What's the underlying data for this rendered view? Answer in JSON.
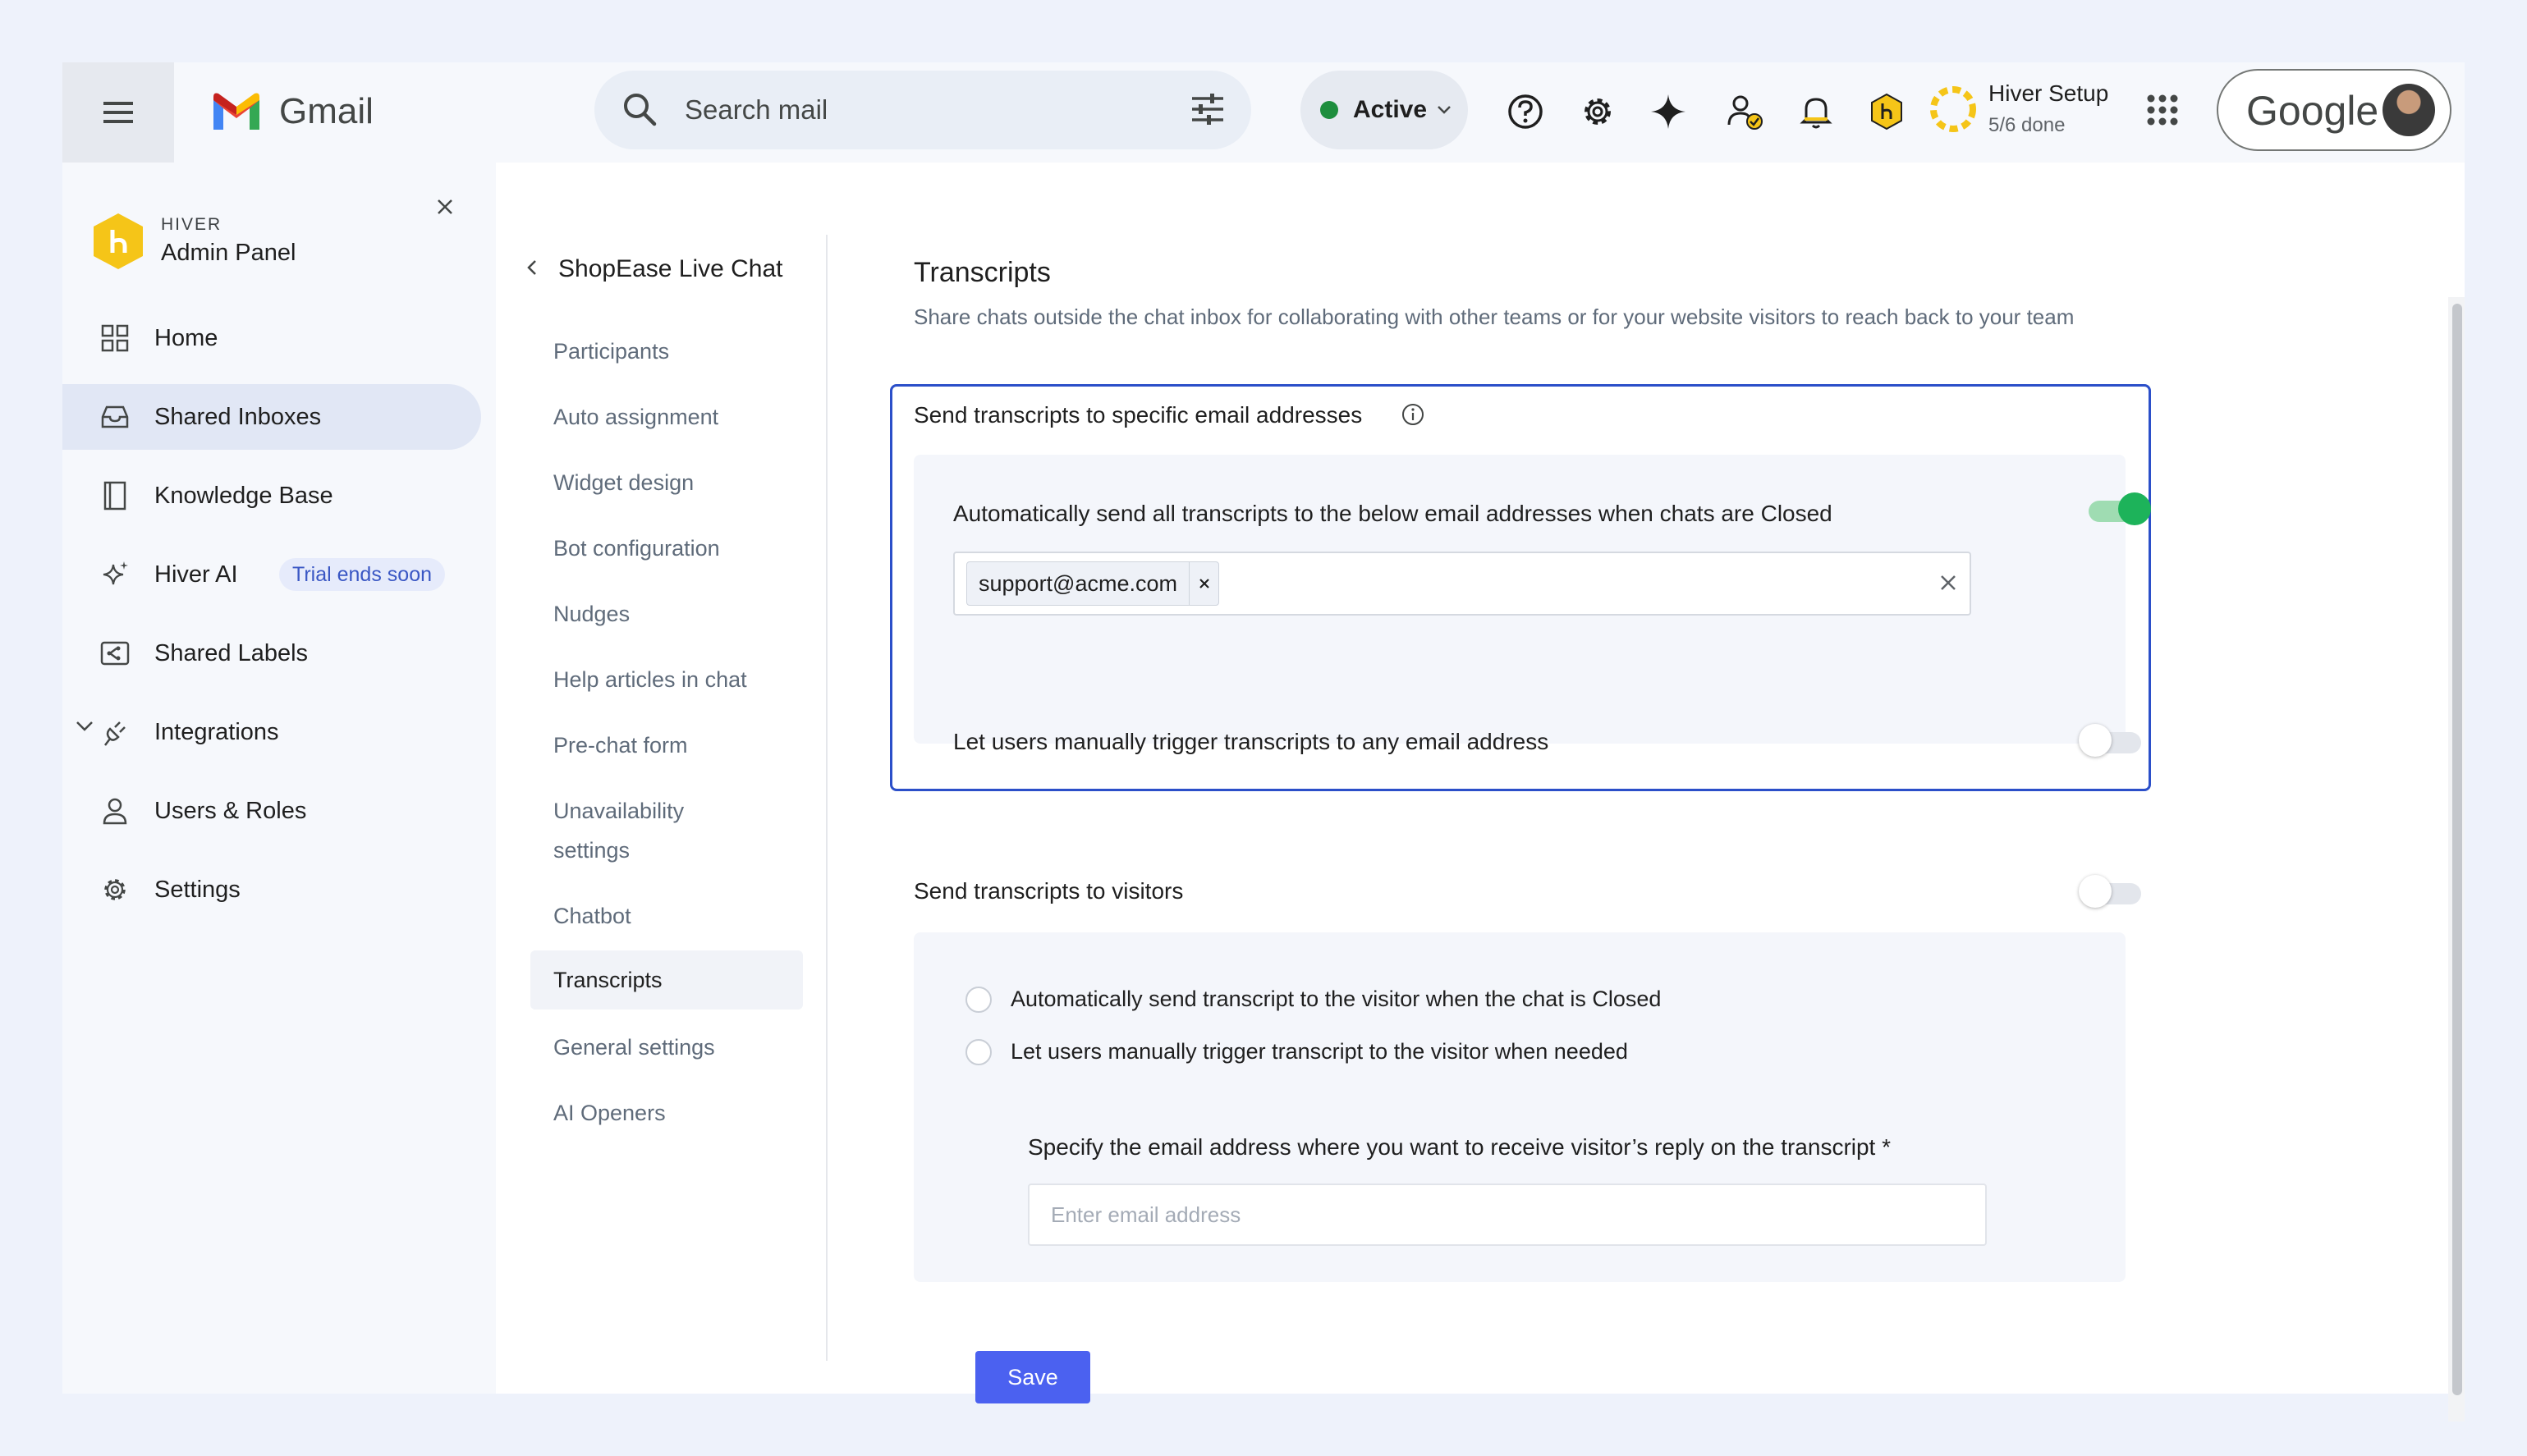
{
  "topbar": {
    "app_name": "Gmail",
    "search_placeholder": "Search mail",
    "status": "Active",
    "setup_title": "Hiver Setup",
    "setup_progress": "5/6 done",
    "google_label": "Google"
  },
  "sidebar": {
    "brand_small": "HIVER",
    "brand_title": "Admin Panel",
    "items": [
      {
        "label": "Home",
        "icon": "grid-icon"
      },
      {
        "label": "Shared Inboxes",
        "icon": "inbox-icon",
        "active": true
      },
      {
        "label": "Knowledge Base",
        "icon": "book-icon"
      },
      {
        "label": "Hiver AI",
        "icon": "sparkle-icon",
        "badge": "Trial ends soon"
      },
      {
        "label": "Shared Labels",
        "icon": "label-icon"
      },
      {
        "label": "Integrations",
        "icon": "plug-icon"
      },
      {
        "label": "Users & Roles",
        "icon": "user-icon"
      },
      {
        "label": "Settings",
        "icon": "gear-icon"
      }
    ]
  },
  "subnav": {
    "title": "ShopEase Live Chat",
    "items": [
      "Participants",
      "Auto assignment",
      "Widget design",
      "Bot configuration",
      "Nudges",
      "Help articles in chat",
      "Pre-chat form",
      "Unavailability",
      "settings",
      "Chatbot",
      "Transcripts",
      "General settings",
      "AI Openers"
    ],
    "active": "Transcripts"
  },
  "main": {
    "title": "Transcripts",
    "description": "Share chats outside the chat inbox for collaborating with other teams or for your website visitors to reach back to your team",
    "email_section": {
      "title": "Send transcripts to specific email addresses",
      "auto_label": "Automatically send all transcripts to the below email addresses when chats are Closed",
      "auto_enabled": true,
      "emails": [
        "support@acme.com"
      ],
      "manual_label": "Let users manually trigger transcripts to any email address",
      "manual_enabled": false
    },
    "visitor_section": {
      "title": "Send transcripts to visitors",
      "enabled": false,
      "option_auto": "Automatically send transcript to the visitor when the chat is Closed",
      "option_manual": "Let users manually trigger transcript to the visitor when needed",
      "reply_label": "Specify the email address where you want to receive visitor’s reply on the transcript *",
      "reply_placeholder": "Enter email address"
    },
    "save_label": "Save"
  },
  "colors": {
    "accent": "#4b61f0",
    "toggle_on": "#1db35a",
    "focus_border": "#2b4fc9",
    "active_status": "#1e8e3e",
    "hiver_yellow": "#f5c518"
  }
}
